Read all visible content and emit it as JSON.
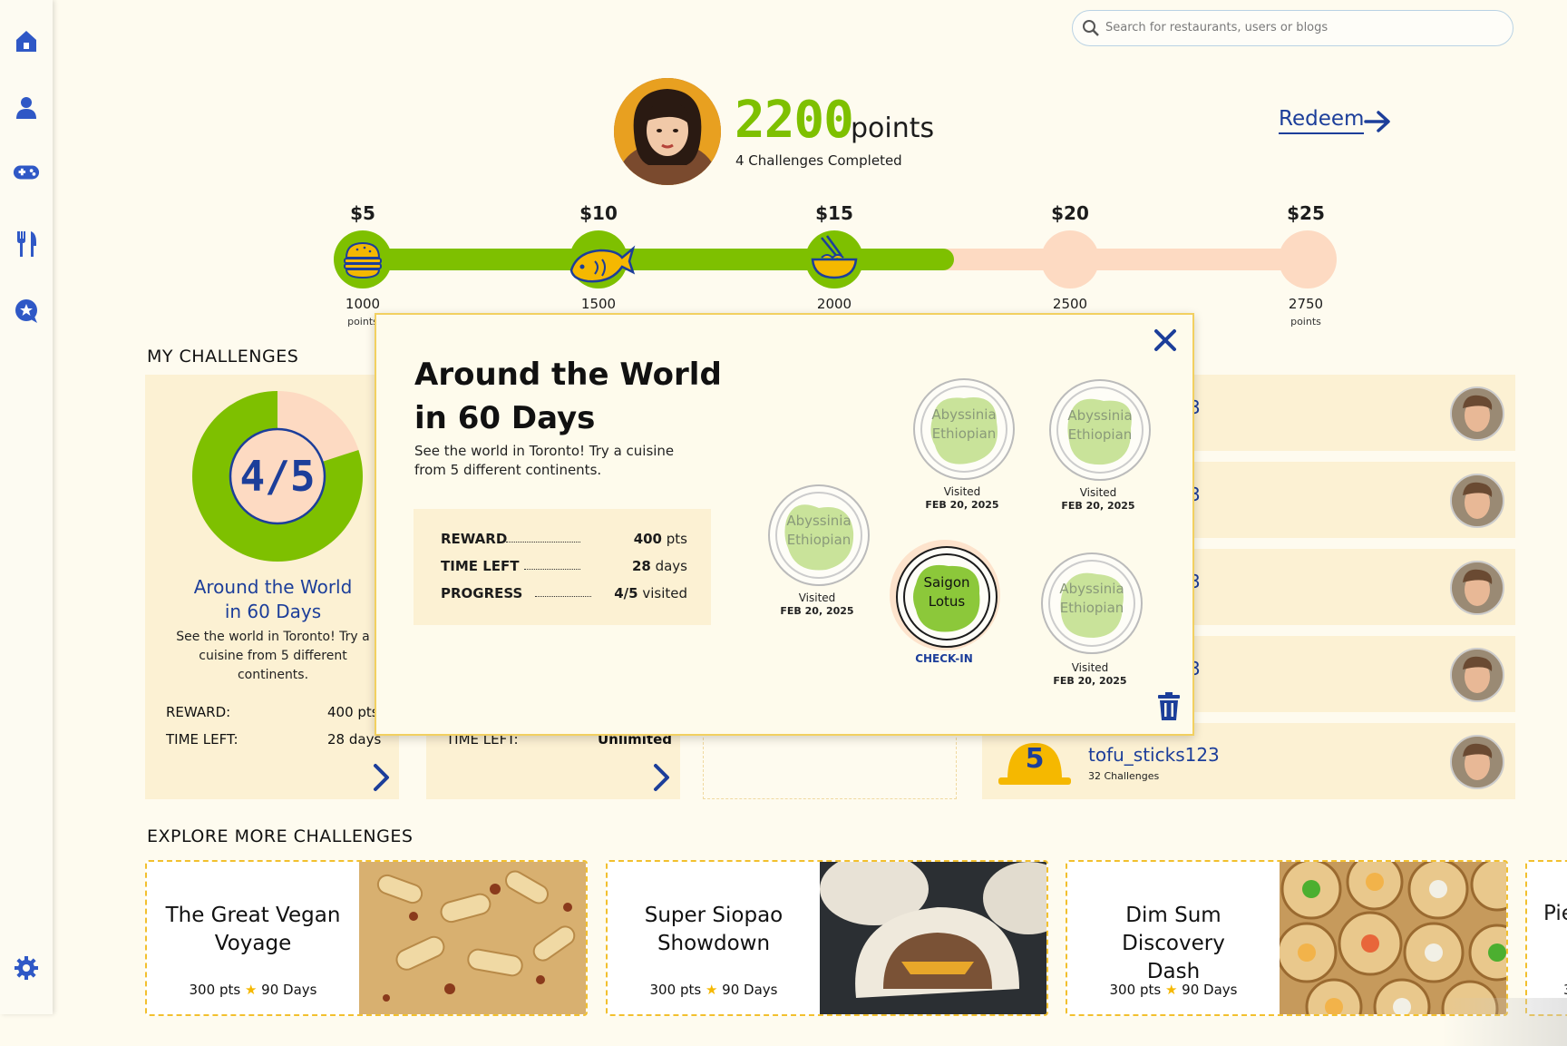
{
  "search": {
    "placeholder": "Search for restaurants, users or blogs"
  },
  "sidebar": {
    "icons": [
      "home-icon",
      "user-icon",
      "gamepad-icon",
      "utensils-icon",
      "star-chat-icon",
      "gear-icon"
    ]
  },
  "profile": {
    "points": "2200",
    "points_label": "points",
    "completed": "4 Challenges Completed",
    "redeem_label": "Redeem"
  },
  "tiers": [
    {
      "amount": "$5",
      "points": "1000",
      "unit": "points"
    },
    {
      "amount": "$10",
      "points": "1500",
      "unit": ""
    },
    {
      "amount": "$15",
      "points": "2000",
      "unit": ""
    },
    {
      "amount": "$20",
      "points": "2500",
      "unit": ""
    },
    {
      "amount": "$25",
      "points": "2750",
      "unit": "points"
    }
  ],
  "my_challenges": {
    "title": "MY CHALLENGES",
    "card1": {
      "progress_text": "4/5",
      "progress_fraction": 0.8,
      "title_line1": "Around the World",
      "title_line2": "in 60 Days",
      "desc": "See the world in Toronto! Try a cuisine from 5 different continents.",
      "reward_label": "REWARD:",
      "reward_value": "400 pts",
      "time_label": "TIME LEFT:",
      "time_value": "28 days"
    },
    "card2": {
      "time_label": "TIME LEFT:",
      "time_value": "Unlimited"
    }
  },
  "leaderboard": {
    "rows": [
      {
        "name_fragment": "3"
      },
      {
        "name_fragment": "3"
      },
      {
        "name_fragment": "3"
      },
      {
        "name_fragment": "3"
      },
      {
        "rank": "5",
        "name": "tofu_sticks123",
        "sub": "32 Challenges"
      }
    ]
  },
  "explore": {
    "title": "EXPLORE  MORE CHALLENGES",
    "cards": [
      {
        "title_line1": "The Great Vegan",
        "title_line2": "Voyage",
        "pts": "300",
        "pts_unit": "pts",
        "days": "90",
        "days_unit": "Days"
      },
      {
        "title_line1": "Super Siopao",
        "title_line2": "Showdown",
        "pts": "300",
        "pts_unit": "pts",
        "days": "90",
        "days_unit": "Days"
      },
      {
        "title_line1": "Dim Sum Discovery",
        "title_line2": "Dash",
        "pts": "300",
        "pts_unit": "pts",
        "days": "90",
        "days_unit": "Days"
      },
      {
        "title_line1": "Pie",
        "pts_partial": "3"
      }
    ]
  },
  "modal": {
    "title_line1": "Around the World",
    "title_line2": "in 60 Days",
    "desc": "See the world in Toronto! Try a cuisine from 5 different continents.",
    "reward_label": "REWARD",
    "reward_num": "400",
    "reward_unit": "pts",
    "time_label": "TIME LEFT",
    "time_num": "28",
    "time_unit": "days",
    "progress_label": "PROGRESS",
    "progress_num": "4/5",
    "progress_unit": "visited",
    "plates": [
      {
        "line1": "Abyssinia",
        "line2": "Ethiopian",
        "status": "Visited",
        "date": "FEB 20, 2025"
      },
      {
        "line1": "Abyssinia",
        "line2": "Ethiopian",
        "status": "Visited",
        "date": "FEB 20, 2025"
      },
      {
        "line1": "Abyssinia",
        "line2": "Ethiopian",
        "status": "Visited",
        "date": "FEB 20, 2025"
      },
      {
        "line1": "Saigon",
        "line2": "Lotus",
        "status": "CHECK-IN"
      },
      {
        "line1": "Abyssinia",
        "line2": "Ethiopian",
        "status": "Visited",
        "date": "FEB 20, 2025"
      }
    ]
  },
  "colors": {
    "accent_green": "#7ec000",
    "accent_blue": "#1c3e9a",
    "peach": "#fddac2",
    "card_bg": "#fcf1d3",
    "yellow": "#f5b800"
  }
}
